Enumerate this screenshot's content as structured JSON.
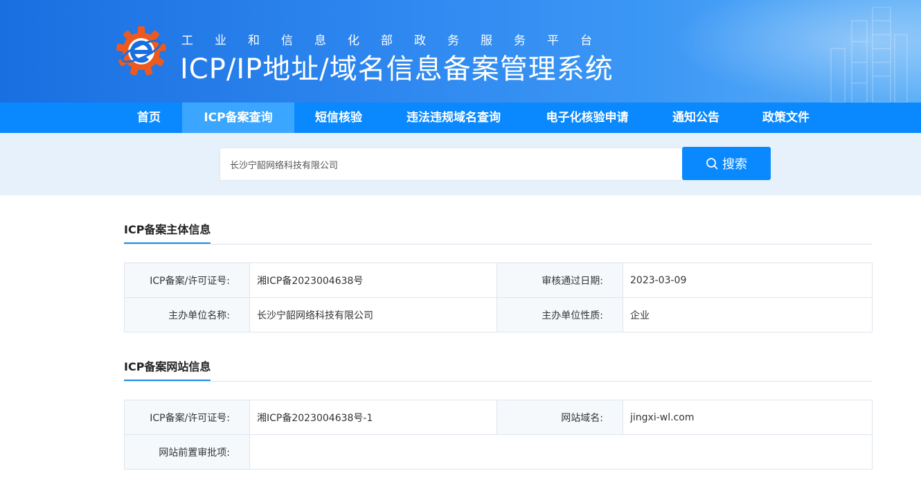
{
  "header": {
    "subtitle": "工业和信息化部政务服务平台",
    "title": "ICP/IP地址/域名信息备案管理系统"
  },
  "nav": {
    "items": [
      {
        "label": "首页"
      },
      {
        "label": "ICP备案查询",
        "active": true
      },
      {
        "label": "短信核验"
      },
      {
        "label": "违法违规域名查询"
      },
      {
        "label": "电子化核验申请"
      },
      {
        "label": "通知公告"
      },
      {
        "label": "政策文件"
      }
    ]
  },
  "search": {
    "value": "长沙宁韶网络科技有限公司",
    "button_label": "搜索",
    "icon": "search-icon"
  },
  "subject_section": {
    "title": "ICP备案主体信息",
    "rows": [
      {
        "label1": "ICP备案/许可证号:",
        "value1": "湘ICP备2023004638号",
        "label2": "审核通过日期:",
        "value2": "2023-03-09"
      },
      {
        "label1": "主办单位名称:",
        "value1": "长沙宁韶网络科技有限公司",
        "label2": "主办单位性质:",
        "value2": "企业"
      }
    ]
  },
  "website_section": {
    "title": "ICP备案网站信息",
    "row1": {
      "label1": "ICP备案/许可证号:",
      "value1": "湘ICP备2023004638号-1",
      "label2": "网站域名:",
      "value2": "jingxi-wl.com"
    },
    "row2": {
      "label": "网站前置审批项:",
      "value": ""
    }
  },
  "colors": {
    "nav_bg": "#0a89ff",
    "nav_active_bg": "#3aa6ff",
    "accent": "#1b8cf0",
    "search_band_bg": "#e6f1fc"
  }
}
